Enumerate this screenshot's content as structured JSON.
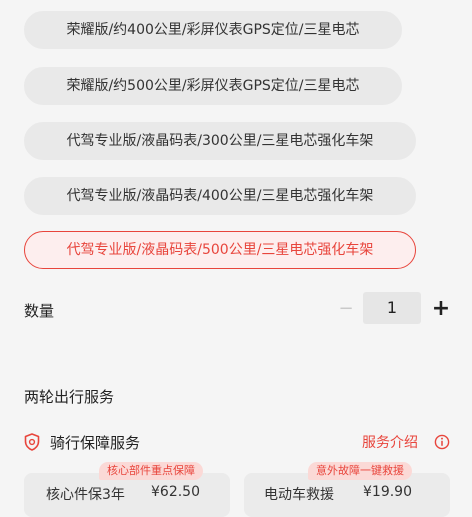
{
  "options": [
    {
      "label": "荣耀版/约400公里/彩屏仪表GPS定位/三星电芯",
      "selected": false
    },
    {
      "label": "荣耀版/约500公里/彩屏仪表GPS定位/三星电芯",
      "selected": false
    },
    {
      "label": "代驾专业版/液晶码表/300公里/三星电芯强化车架",
      "selected": false
    },
    {
      "label": "代驾专业版/液晶码表/400公里/三星电芯强化车架",
      "selected": false
    },
    {
      "label": "代驾专业版/液晶码表/500公里/三星电芯强化车架",
      "selected": true
    }
  ],
  "quantity": {
    "label": "数量",
    "minus": "−",
    "value": "1",
    "plus": "+"
  },
  "travel_services": {
    "title": "两轮出行服务",
    "riding_protection": {
      "icon": "shield-icon",
      "title": "骑行保障服务",
      "link": "服务介绍",
      "link_icon": "info-icon"
    },
    "cards": [
      {
        "tag": "核心部件重点保障",
        "name": "核心件保3年",
        "price": "¥62.50"
      },
      {
        "tag": "意外故障一键救援",
        "name": "电动车救援",
        "price": "¥19.90"
      }
    ]
  },
  "colors": {
    "accent": "#e8453c",
    "accent_bg": "#fdeeee",
    "option_bg": "#e9e9e9",
    "page_bg": "#f5f5f5"
  }
}
